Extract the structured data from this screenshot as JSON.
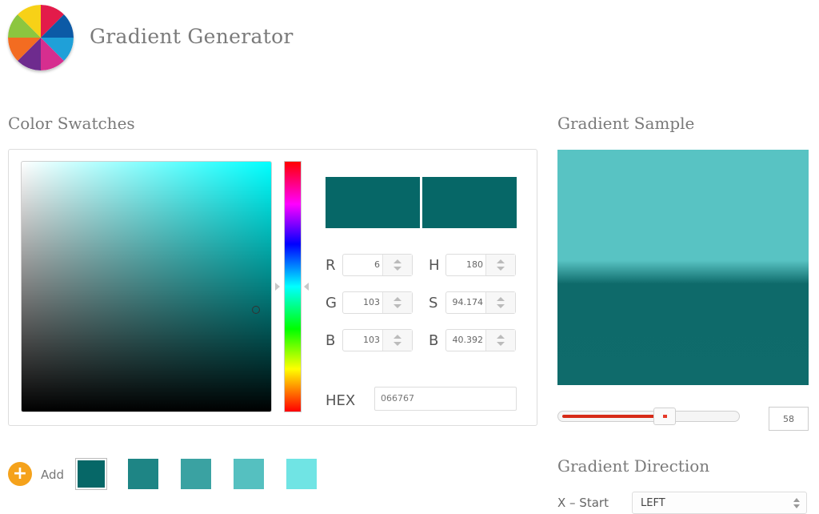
{
  "app": {
    "title": "Gradient Generator",
    "logo_icon": "color-wheel-icon"
  },
  "swatches_section": {
    "title": "Color Swatches"
  },
  "picker": {
    "preview_color": "#066767",
    "rgb": [
      {
        "label": "R",
        "value": "6"
      },
      {
        "label": "G",
        "value": "103"
      },
      {
        "label": "B",
        "value": "103"
      }
    ],
    "hsb": [
      {
        "label": "H",
        "value": "180"
      },
      {
        "label": "S",
        "value": "94.174"
      },
      {
        "label": "B",
        "value": "40.392"
      }
    ],
    "hex_label": "HEX",
    "hex_value": "066767"
  },
  "sample_section": {
    "title": "Gradient Sample",
    "top_color": "#58c3c3",
    "bottom_color": "#0f6b6b",
    "slider_value": "58"
  },
  "swatch_bar": {
    "add_icon": "plus-icon",
    "add_label": "Add",
    "swatches": [
      {
        "color": "#066767",
        "selected": true
      },
      {
        "color": "#1e8585",
        "selected": false
      },
      {
        "color": "#3aa2a2",
        "selected": false
      },
      {
        "color": "#55c0c0",
        "selected": false
      },
      {
        "color": "#70e4e4",
        "selected": false
      }
    ]
  },
  "direction_section": {
    "title": "Gradient Direction",
    "x_start_label": "X – Start",
    "x_start_value": "LEFT"
  }
}
